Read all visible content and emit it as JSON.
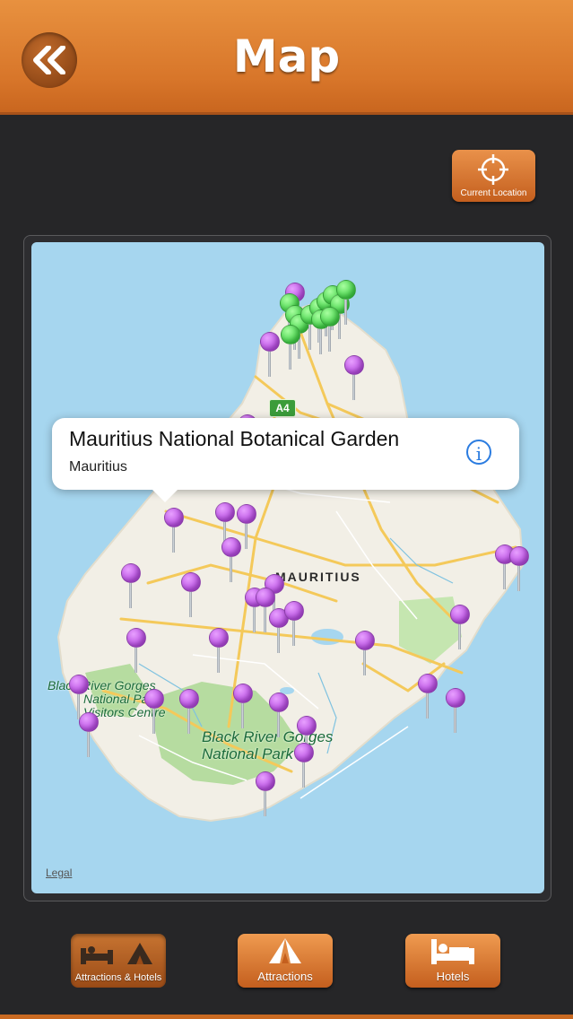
{
  "header": {
    "title": "Map",
    "back_button": "double-chevron-left-icon"
  },
  "current_location": {
    "label": "Current Location",
    "icon": "crosshair-icon"
  },
  "map": {
    "country_label": "MAURITIUS",
    "road_badge": "A4",
    "park_labels": {
      "visitors_centre": [
        "Black River Gorges",
        "National Park",
        "Visitors Centre"
      ],
      "national_park": [
        "Black River Gorges",
        "National Park"
      ]
    },
    "legal_link": "Legal"
  },
  "callout": {
    "title": "Mauritius National Botanical Garden",
    "subtitle": "Mauritius",
    "info_icon": "info-icon"
  },
  "tabs": [
    {
      "label": "Attractions & Hotels",
      "icon": "bed-tent-icon",
      "active": true
    },
    {
      "label": "Attractions",
      "icon": "tent-icon",
      "active": false
    },
    {
      "label": "Hotels",
      "icon": "bed-icon",
      "active": false
    }
  ],
  "colors": {
    "accent": "#d8762a",
    "background": "#262628",
    "water": "#a6d6ef",
    "land": "#f2efe6",
    "park": "#b6dca0",
    "pin_purple": "#b64be0",
    "pin_green": "#3fcf45"
  }
}
